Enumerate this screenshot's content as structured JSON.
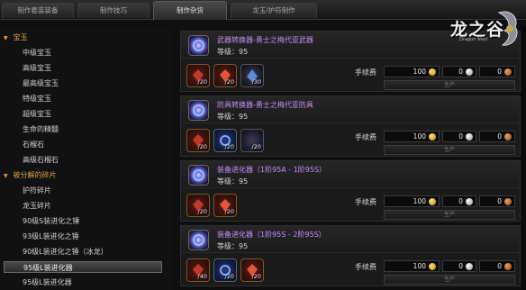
{
  "tabs": [
    {
      "label": "制作套装装备"
    },
    {
      "label": "制作技巧"
    },
    {
      "label": "制作杂货"
    },
    {
      "label": "龙玉/护符制作"
    }
  ],
  "logo": {
    "text": "龙之谷",
    "sub": "Dragon Nest"
  },
  "sidebar": {
    "categories": [
      {
        "label": "宝玉",
        "arrow": "▼"
      },
      {
        "label": "被分解的碎片",
        "arrow": "▼"
      }
    ],
    "items": [
      {
        "label": "中级宝玉"
      },
      {
        "label": "高级宝玉"
      },
      {
        "label": "最高级宝玉"
      },
      {
        "label": "特级宝玉"
      },
      {
        "label": "超级宝玉"
      },
      {
        "label": "生命的精髓"
      },
      {
        "label": "石榴石"
      },
      {
        "label": "高级石榴石"
      },
      {
        "label": "护符碎片"
      },
      {
        "label": "龙玉碎片"
      },
      {
        "label": "90级S装进化之锤"
      },
      {
        "label": "93级L装进化之锤"
      },
      {
        "label": "90级L装进化之锤（冰龙）"
      },
      {
        "label": "95级L装进化器"
      },
      {
        "label": "95级L装进化器"
      }
    ]
  },
  "recipes": [
    {
      "title": "武器转换器-勇士之梅代亚武器",
      "level": "等级：95",
      "materials": [
        {
          "qty": "/20"
        },
        {
          "qty": "/20"
        },
        {
          "qty": "/30"
        }
      ],
      "fee_label": "手续费",
      "fee_gold": "100",
      "fee_silver": "0",
      "fee_copper": "0",
      "produce": "生产"
    },
    {
      "title": "防具转换器-勇士之梅代亚防具",
      "level": "等级：95",
      "materials": [
        {
          "qty": "/20"
        },
        {
          "qty": "/20"
        },
        {
          "qty": "/20"
        }
      ],
      "fee_label": "手续费",
      "fee_gold": "100",
      "fee_silver": "0",
      "fee_copper": "0",
      "produce": "生产"
    },
    {
      "title": "装备进化器（1阶95A - 1阶95S）",
      "level": "等级：95",
      "materials": [
        {
          "qty": "/20"
        },
        {
          "qty": "/20"
        }
      ],
      "fee_label": "手续费",
      "fee_gold": "100",
      "fee_silver": "0",
      "fee_copper": "0",
      "produce": "生产"
    },
    {
      "title": "装备进化器（1阶95S - 2阶95S）",
      "level": "等级：95",
      "materials": [
        {
          "qty": "/40"
        },
        {
          "qty": "/20"
        },
        {
          "qty": "/20"
        }
      ],
      "fee_label": "手续费",
      "fee_gold": "100",
      "fee_silver": "0",
      "fee_copper": "0",
      "produce": "生产"
    }
  ],
  "colors": {
    "title_purple": "#c890ff",
    "category_gold": "#d9a441"
  },
  "icons": {
    "main": "converter-orb-icon",
    "material": "crystal-icon",
    "gold": "gold-coin-icon",
    "silver": "silver-coin-icon",
    "copper": "copper-coin-icon"
  }
}
